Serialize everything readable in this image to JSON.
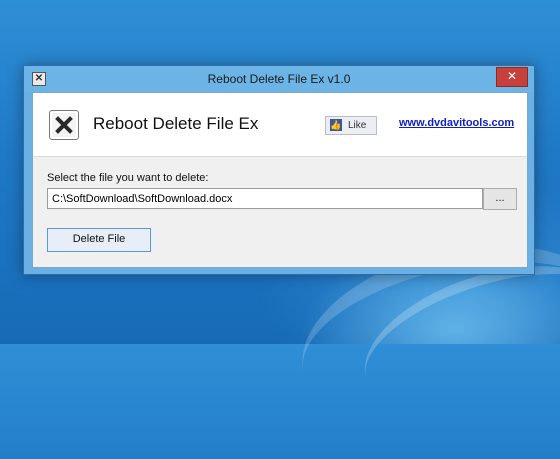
{
  "window": {
    "title": "Reboot Delete File Ex v1.0",
    "close_glyph": "✕"
  },
  "header": {
    "app_name": "Reboot Delete File Ex",
    "like_label": "Like",
    "website": "www.dvdavitools.com"
  },
  "form": {
    "prompt": "Select the file you want to delete:",
    "file_path": "C:\\SoftDownload\\SoftDownload.docx",
    "browse_label": "...",
    "delete_label": "Delete File"
  },
  "icons": {
    "app": "x-icon",
    "like": "thumbs-up-icon",
    "close": "close-icon"
  },
  "colors": {
    "titlebar": "#6cb3e6",
    "close_button": "#c7403b",
    "link": "#1020c0",
    "delete_button_border": "#5b9ad6"
  }
}
